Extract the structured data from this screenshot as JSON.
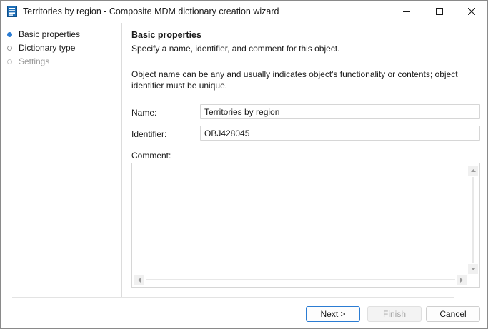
{
  "window": {
    "title": "Territories by region - Composite MDM dictionary creation wizard",
    "icon": "dictionary-icon"
  },
  "steps": [
    {
      "label": "Basic properties",
      "state": "active"
    },
    {
      "label": "Dictionary type",
      "state": "pending"
    },
    {
      "label": "Settings",
      "state": "disabled"
    }
  ],
  "section": {
    "title": "Basic properties",
    "subtitle": "Specify a name, identifier, and comment for this object.",
    "description": "Object name can be any and usually indicates object's functionality or contents; object identifier must be unique."
  },
  "fields": {
    "name_label": "Name:",
    "name_value": "Territories by region",
    "identifier_label": "Identifier:",
    "identifier_value": "OBJ428045",
    "comment_label": "Comment:",
    "comment_value": ""
  },
  "buttons": {
    "next": "Next >",
    "finish": "Finish",
    "cancel": "Cancel"
  },
  "colors": {
    "accent": "#2b7cd3",
    "disabled_text": "#9a9a9a"
  }
}
